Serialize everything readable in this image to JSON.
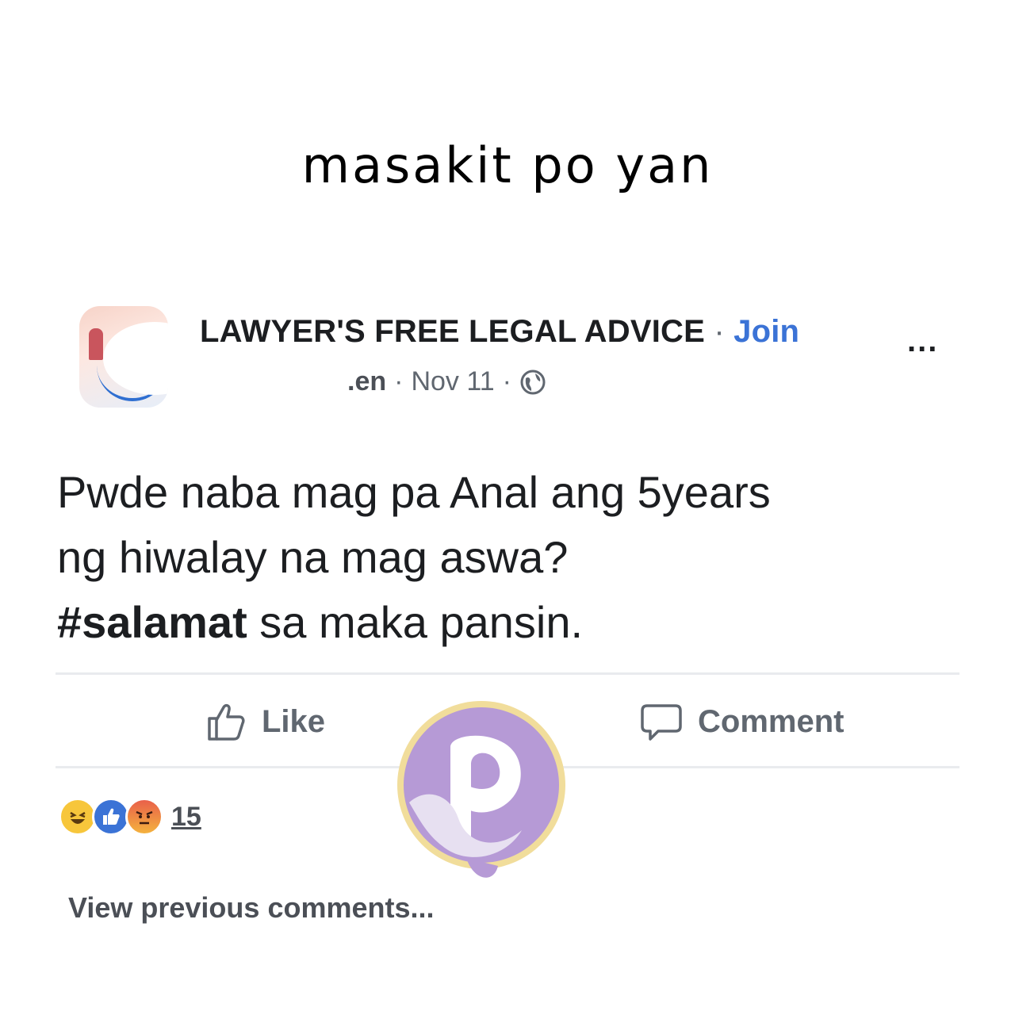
{
  "caption": "masakit po yan",
  "post_header": {
    "group_name": "LAWYER'S FREE LEGAL ADVICE",
    "separator": " · ",
    "join_label": "Join",
    "more_label": "...",
    "author_partial": ".en",
    "date": "Nov 11",
    "privacy_icon": "globe-icon"
  },
  "post_body": {
    "line1": "Pwde naba mag pa Anal ang 5years",
    "line2": "ng hiwalay na mag aswa?",
    "hashtag": "#salamat",
    "line3_rest": " sa maka pansin."
  },
  "actions": {
    "like_label": "Like",
    "comment_label": "Comment"
  },
  "reactions": {
    "icons": [
      "haha-reaction-icon",
      "like-reaction-icon",
      "angry-reaction-icon"
    ],
    "count": "15"
  },
  "view_previous_label": "View previous comments...",
  "colors": {
    "link_blue": "#3b73d6",
    "text_dark": "#1c1e21",
    "text_gray": "#606770",
    "watermark_purple": "#b69ad6",
    "watermark_gold": "#f1dd9b"
  }
}
